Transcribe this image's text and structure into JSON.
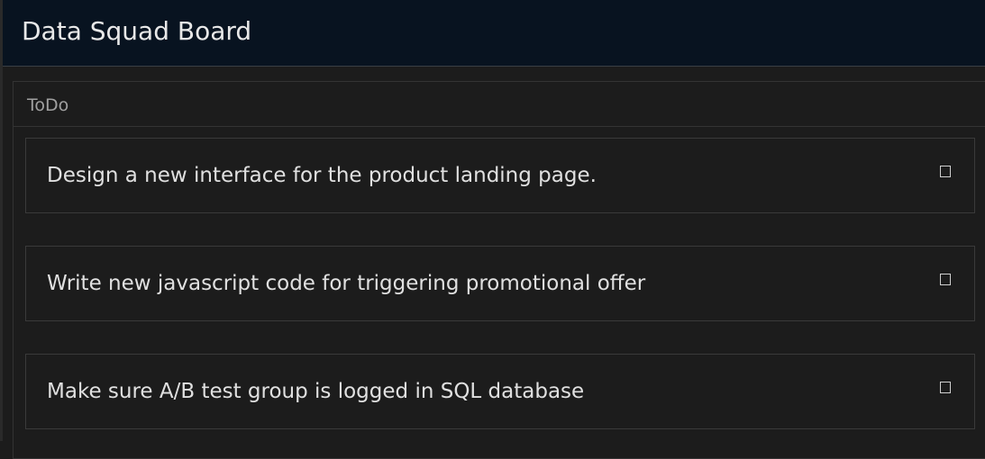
{
  "header": {
    "title": "Data Squad Board"
  },
  "columns": [
    {
      "title": "ToDo",
      "tasks": [
        {
          "text": "Design a new interface for the product landing page.",
          "checked": false
        },
        {
          "text": "Write new javascript code for triggering promotional offer",
          "checked": false
        },
        {
          "text": "Make sure A/B test group is logged in SQL database",
          "checked": false
        }
      ]
    }
  ],
  "colors": {
    "header_bg": "#081320",
    "page_bg": "#1c1c1c",
    "card_border": "#3a3a3a",
    "text_primary": "#e0e0e0",
    "text_muted": "#a0a0a0"
  }
}
